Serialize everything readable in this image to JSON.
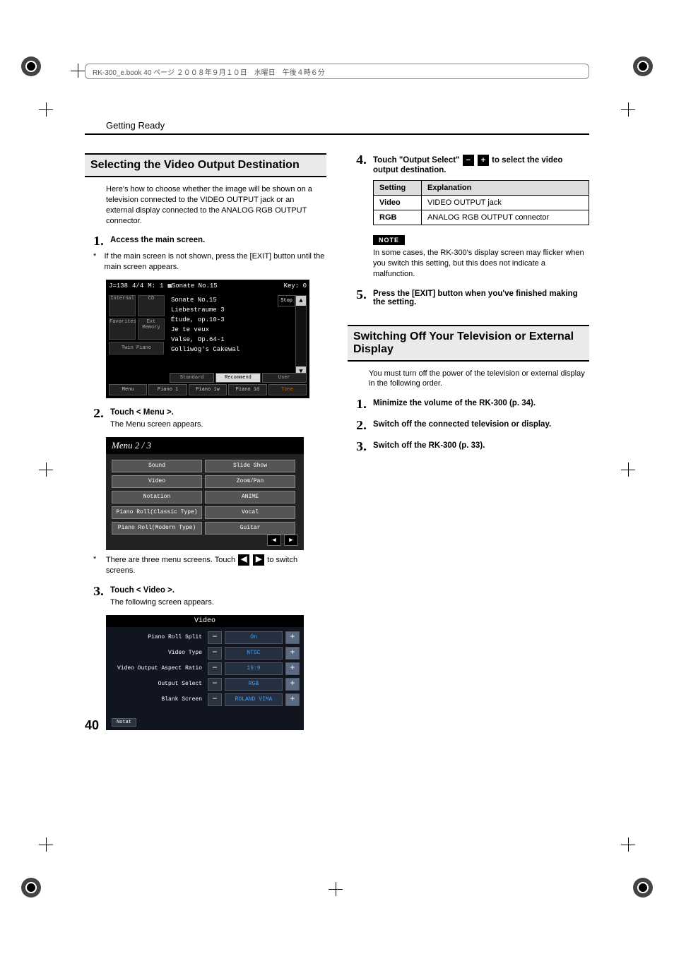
{
  "header_text": "RK-300_e.book  40 ページ  ２００８年９月１０日　水曜日　午後４時６分",
  "running_head": "Getting Ready",
  "page_number": "40",
  "left": {
    "h2": "Selecting the Video Output Destination",
    "intro": "Here's how to choose whether the image will be shown on a television connected to the VIDEO OUTPUT jack or an external display connected to the ANALOG RGB OUTPUT connector.",
    "step1_title": "Access the main screen.",
    "step1_note": "If the main screen is not shown, press the [EXIT] button until the main screen appears.",
    "step2_title": "Touch < Menu >.",
    "step2_text": "The Menu screen appears.",
    "step2_note_a": "There are three menu screens. Touch",
    "step2_note_b": "to switch screens.",
    "step3_title": "Touch < Video >.",
    "step3_text": "The following screen appears.",
    "main_screen": {
      "top": [
        "J=138",
        "4/4",
        "M:",
        "1",
        "▦Sonate No.15",
        "Key: 0"
      ],
      "tiles": [
        "Internal",
        "CD",
        "Favorites",
        "Ext Memory",
        "Twin Piano"
      ],
      "songs": [
        "Sonate No.15",
        "Liebestraume 3",
        "Étude, op.10-3",
        "Je te veux",
        "Valse, Op.64-1",
        "Golliwog's Cakewal"
      ],
      "song_tag": "Stop",
      "tabs": [
        "Standard",
        "Recommend",
        "User"
      ],
      "bottom": [
        "Menu",
        "Piano 1",
        "Piano 1w",
        "Piano 1d",
        "Tone"
      ]
    },
    "menu_screen": {
      "title": "Menu 2 / 3",
      "items": [
        "Sound",
        "Slide Show",
        "Video",
        "Zoom/Pan",
        "Notation",
        "ANIME",
        "Piano Roll(Classic Type)",
        "Vocal",
        "Piano Roll(Modern Type)",
        "Guitar"
      ]
    },
    "video_screen": {
      "title": "Video",
      "rows": [
        {
          "label": "Piano Roll Split",
          "value": "On"
        },
        {
          "label": "Video Type",
          "value": "NTSC"
        },
        {
          "label": "Video Output Aspect Ratio",
          "value": "16:9"
        },
        {
          "label": "Output Select",
          "value": "RGB"
        },
        {
          "label": "Blank Screen",
          "value": "ROLAND VIMA"
        }
      ],
      "notat": "Notat"
    }
  },
  "right": {
    "step4_a": "Touch \"Output Select\"",
    "step4_b": "to select the video output destination.",
    "table": {
      "head": [
        "Setting",
        "Explanation"
      ],
      "rows": [
        [
          "Video",
          "VIDEO OUTPUT jack"
        ],
        [
          "RGB",
          "ANALOG RGB OUTPUT connector"
        ]
      ]
    },
    "note_label": "NOTE",
    "note_text": "In some cases, the RK-300's display screen may flicker when you switch this setting, but this does not indicate a malfunction.",
    "step5_title": "Press the [EXIT] button when you've finished making the setting.",
    "h2": "Switching Off Your Television or External Display",
    "intro": "You must turn off the power of the television or external display in the following order.",
    "step1": "Minimize the volume of the RK-300 (p. 34).",
    "step2": "Switch off the connected television or display.",
    "step3": "Switch off the RK-300 (p. 33)."
  },
  "glyph": {
    "left": "◀",
    "right": "▶",
    "minus": "−",
    "plus": "+",
    "up": "▲",
    "down": "▼"
  }
}
